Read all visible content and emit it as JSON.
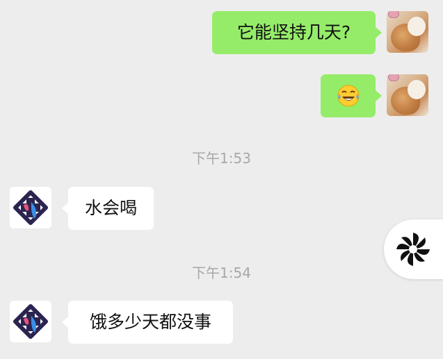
{
  "messages": [
    {
      "side": "right",
      "type": "text",
      "text": "它能坚持几天?"
    },
    {
      "side": "right",
      "type": "emoji",
      "emoji": "😂"
    },
    {
      "type": "time",
      "text": "下午1:53"
    },
    {
      "side": "left",
      "type": "text",
      "text": "水会喝"
    },
    {
      "type": "time",
      "text": "下午1:54"
    },
    {
      "side": "left",
      "type": "text",
      "text": "饿多少天都没事"
    }
  ],
  "icons": {
    "user_avatar": "dog-photo-avatar",
    "bot_avatar": "medical-logo-avatar",
    "floating": "pinwheel-icon"
  },
  "colors": {
    "background": "#ededed",
    "sent_bubble": "#95ec69",
    "received_bubble": "#ffffff",
    "timestamp_text": "#a8a8a8"
  }
}
